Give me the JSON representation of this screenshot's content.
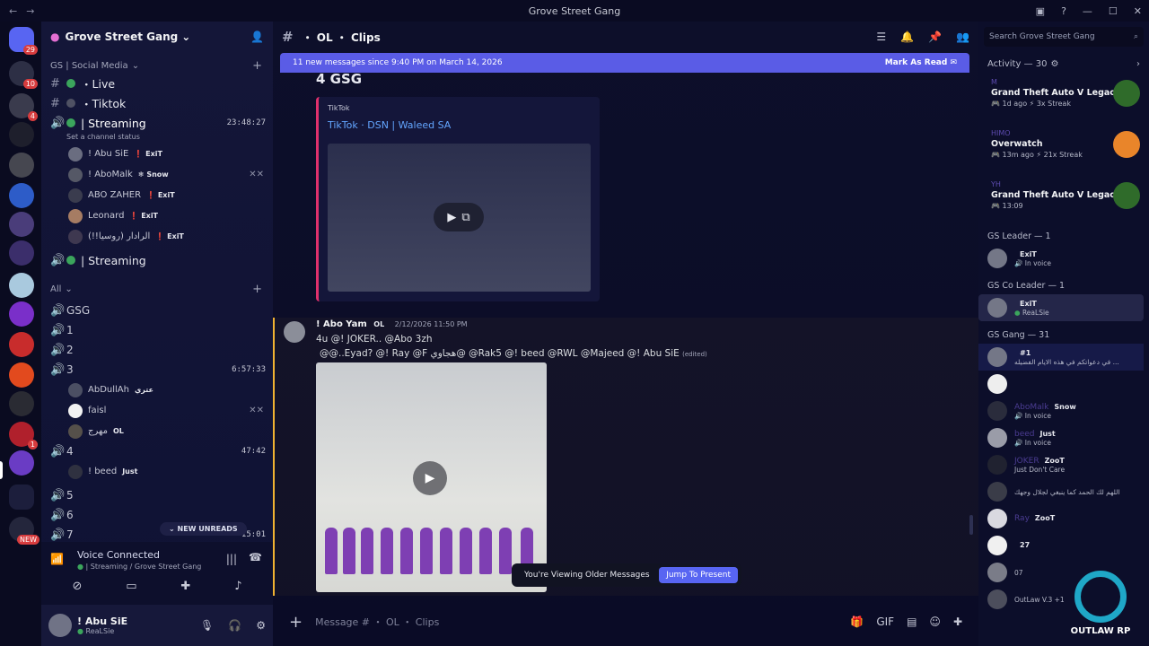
{
  "window": {
    "title": "Grove Street Gang"
  },
  "rail": {
    "home_badge": "29",
    "badges": [
      "10",
      "4",
      "1",
      "NEW"
    ]
  },
  "server": {
    "name": "Grove Street Gang"
  },
  "sidebar": {
    "cat_social": "GS | Social Media",
    "channels_top": [
      {
        "name": "Live",
        "prefix": "・"
      },
      {
        "name": "Tiktok",
        "prefix": "・"
      }
    ],
    "streaming1": {
      "name": "| Streaming",
      "time": "23:48:27",
      "status": "Set a channel status"
    },
    "streaming1_users": [
      {
        "name": "! Abu SiE",
        "tag": "ExiT"
      },
      {
        "name": "! AboMalk",
        "tag": "Snow"
      },
      {
        "name": "ABO ZAHER",
        "tag": "ExiT"
      },
      {
        "name": "Leonard",
        "tag": "ExiT"
      },
      {
        "name": "الرادار (روسيا!!)",
        "tag": "ExiT"
      }
    ],
    "streaming2": {
      "name": "| Streaming"
    },
    "cat_all": "All",
    "voice": [
      {
        "name": "GSG"
      },
      {
        "name": "1"
      },
      {
        "name": "2"
      },
      {
        "name": "3",
        "time": "6:57:33"
      }
    ],
    "ch3_users": [
      {
        "name": "AbDullAh",
        "tag": "عتري"
      },
      {
        "name": "faisl",
        "tag": ""
      },
      {
        "name": "مهرج",
        "tag": "OL"
      }
    ],
    "ch4": {
      "name": "4",
      "time": "47:42"
    },
    "ch4_users": [
      {
        "name": "! beed",
        "tag": "Just"
      }
    ],
    "voice_after": [
      {
        "name": "5"
      },
      {
        "name": "6"
      },
      {
        "name": "7",
        "time": "15:01"
      }
    ],
    "new_unreads": "NEW UNREADS",
    "voice_panel": {
      "title": "Voice Connected",
      "sub": "| Streaming / Grove Street Gang"
    },
    "user": {
      "name": "! Abu SiE",
      "status": "ReaLSie"
    }
  },
  "channel": {
    "title": "・ OL ・ Clips",
    "newbar_text": "11 new messages since 9:40 PM on March 14, 2026",
    "mark_read": "Mark As Read",
    "heading": "4 GSG",
    "embed": {
      "provider": "TikTok",
      "title": "TikTok · DSN | Waleed SA"
    },
    "message": {
      "author": "! Abo Yam",
      "badge": "OL",
      "timestamp": "2/12/2026 11:50 PM",
      "line1": "4u @! JOKER.. @Abo 3zh",
      "line2": "@@..Eyad? @! Ray @F هجاوي@ @Rak5 @! beed @RWL @Majeed @!             Abu SiE",
      "edited": "(edited)"
    },
    "older_text": "You're Viewing Older Messages",
    "jump_label": "Jump To Present",
    "composer_placeholder": "Message # ・ OL ・ Clips"
  },
  "right": {
    "search_placeholder": "Search Grove Street Gang",
    "activity_head": "Activity — 30",
    "activities": [
      {
        "who": "M",
        "game": "Grand Theft Auto V Legacy",
        "meta1": "1d ago",
        "meta2": "3x Streak",
        "logo_color": "#2f6b2a"
      },
      {
        "who": "HIMO",
        "game": "Overwatch",
        "meta1": "13m ago",
        "meta2": "21x Streak",
        "logo_color": "#e9852a"
      },
      {
        "who": "YH",
        "game": "Grand Theft Auto V Legacy",
        "meta1": "13:09",
        "meta2": "",
        "logo_color": "#2f6b2a"
      }
    ],
    "groups": [
      {
        "title": "GS Leader — 1",
        "members": [
          {
            "name": "",
            "tag": "ExiT",
            "sub": "In voice"
          }
        ]
      },
      {
        "title": "GS Co Leader — 1",
        "members": [
          {
            "name": "",
            "tag": "ExiT",
            "sub": "ReaLSie",
            "hl": true
          }
        ]
      },
      {
        "title": "GS Gang — 31",
        "members": [
          {
            "name": "",
            "tag": "#1",
            "sub": "في دعواتكم في هذه الايام الفضيله ..."
          },
          {
            "name": "",
            "tag": "",
            "sub": ""
          },
          {
            "name": "AboMalk",
            "tag": "Snow",
            "sub": "In voice"
          },
          {
            "name": "beed",
            "tag": "Just",
            "sub": "In voice"
          },
          {
            "name": "JOKER",
            "tag": "ZooT",
            "sub": "Just Don't Care"
          },
          {
            "name": "",
            "tag": "",
            "sub": "اللهم لك الحمد كما ينبغي لجلال وجهك"
          },
          {
            "name": "Ray",
            "tag": "ZooT",
            "sub": ""
          },
          {
            "name": "",
            "tag": "27",
            "sub": ""
          },
          {
            "name": "",
            "tag": "",
            "sub": "07"
          },
          {
            "name": "",
            "tag": "",
            "sub": "OutLaw V.3 +1"
          }
        ]
      }
    ],
    "watermark": "OUTLAW RP"
  },
  "colors": {
    "accent": "#5a5ce6",
    "green": "#3ba55c",
    "tiktok": "#e1306c"
  }
}
